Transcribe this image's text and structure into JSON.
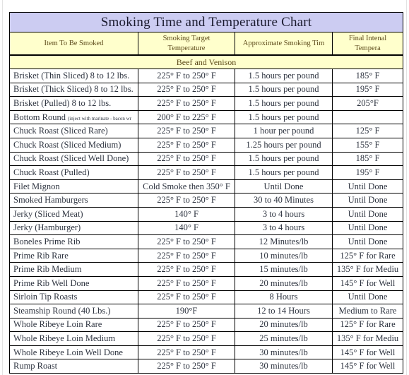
{
  "document": {
    "title": "Smoking Time and Temperature Chart"
  },
  "table": {
    "columns": [
      "Item To Be Smoked",
      "Smoking Target Temperature",
      "Approximate Smoking Tim",
      "Final Intenal Tempera"
    ],
    "column_header_lines": {
      "item": "Item To Be Smoked",
      "target_line1": "Smoking Target",
      "target_line2": "Temperature",
      "approx": "Approximate Smoking Tim",
      "final": "Final Intenal Tempera"
    },
    "sections": [
      {
        "label": "Beef and Venison",
        "rows": [
          {
            "item": "Brisket (Thin Sliced) 8 to 12 lbs.",
            "note": "",
            "target": "225° F to 250° F",
            "time": "1.5 hours per pound",
            "final": "185° F"
          },
          {
            "item": "Brisket (Thick Sliced) 8 to 12 lbs.",
            "note": "",
            "target": "225° F to 250° F",
            "time": "1.5 hours per pound",
            "final": "195° F"
          },
          {
            "item": "Brisket (Pulled) 8 to 12 lbs.",
            "note": "",
            "target": "225° F to 250° F",
            "time": "1.5 hours per pound",
            "final": "205°F"
          },
          {
            "item": "Bottom Round",
            "note": "(inject with marinate - bacon wr",
            "target": "200° F to 225° F",
            "time": "1.5 hours per pound",
            "final": ""
          },
          {
            "item": "Chuck Roast (Sliced Rare)",
            "note": "",
            "target": "225° F to 250° F",
            "time": "1 hour per pound",
            "final": "125° F"
          },
          {
            "item": "Chuck Roast (Sliced Medium)",
            "note": "",
            "target": "225° F to 250° F",
            "time": "1.25 hours per pound",
            "final": "155° F"
          },
          {
            "item": "Chuck Roast (Sliced Well Done)",
            "note": "",
            "target": "225° F to 250° F",
            "time": "1.5 hours per pound",
            "final": "185° F"
          },
          {
            "item": "Chuck Roast (Pulled)",
            "note": "",
            "target": "225° F to 250° F",
            "time": "1.5 hours per pound",
            "final": "195° F"
          },
          {
            "item": "Filet Mignon",
            "note": "",
            "target": "Cold Smoke then 350° F",
            "time": "Until Done",
            "final": "Until Done"
          },
          {
            "item": "Smoked Hamburgers",
            "note": "",
            "target": "225° F to 250° F",
            "time": "30 to 40 Minutes",
            "final": "Until Done"
          },
          {
            "item": "Jerky (Sliced Meat)",
            "note": "",
            "target": "140° F",
            "time": "3 to 4 hours",
            "final": "Until Done"
          },
          {
            "item": "Jerky (Hamburger)",
            "note": "",
            "target": "140° F",
            "time": "3 to 4 hours",
            "final": "Until Done"
          },
          {
            "item": "Boneles Prime Rib",
            "note": "",
            "target": "225° F to 250° F",
            "time": "12 Minutes/lb",
            "final": "Until Done"
          },
          {
            "item": "Prime Rib Rare",
            "note": "",
            "target": "225° F to 250° F",
            "time": "10 minutes/lb",
            "final": "125° F for Rare"
          },
          {
            "item": "Prime Rib Medium",
            "note": "",
            "target": "225° F to 250° F",
            "time": "15 minutes/lb",
            "final": "135° F for Mediu"
          },
          {
            "item": "Prime Rib Well Done",
            "note": "",
            "target": "225° F to 250° F",
            "time": "20 minutes/lb",
            "final": "145° F for Well"
          },
          {
            "item": "Sirloin Tip Roasts",
            "note": "",
            "target": "225° F to 250° F",
            "time": "8 Hours",
            "final": "Until Done"
          },
          {
            "item": "Steamship Round (40 Lbs.)",
            "note": "",
            "target": "190°F",
            "time": "12 to 14 Hours",
            "final": "Medium to Rare"
          },
          {
            "item": "Whole Ribeye Loin Rare",
            "note": "",
            "target": "225° F to 250° F",
            "time": "20 minutes/lb",
            "final": "125° F for Rare"
          },
          {
            "item": "Whole Ribeye Loin Medium",
            "note": "",
            "target": "225° F to 250° F",
            "time": "25 minutes/lb",
            "final": "135° F for Mediu"
          },
          {
            "item": "Whole Ribeye Loin Well Done",
            "note": "",
            "target": "225° F to 250° F",
            "time": "30 minutes/lb",
            "final": "145° F for Well"
          },
          {
            "item": "Rump Roast",
            "note": "",
            "target": "225° F to 250° F",
            "time": "30 minutes/lb",
            "final": "145° F for Well"
          }
        ]
      }
    ]
  },
  "colors": {
    "title_background": "#CCCCF2",
    "header_background": "#FFFFCC",
    "header_text": "#5C4A1A",
    "body_text": "#2E3440",
    "grid_line": "#000000",
    "page_background": "#FFFFFF"
  }
}
